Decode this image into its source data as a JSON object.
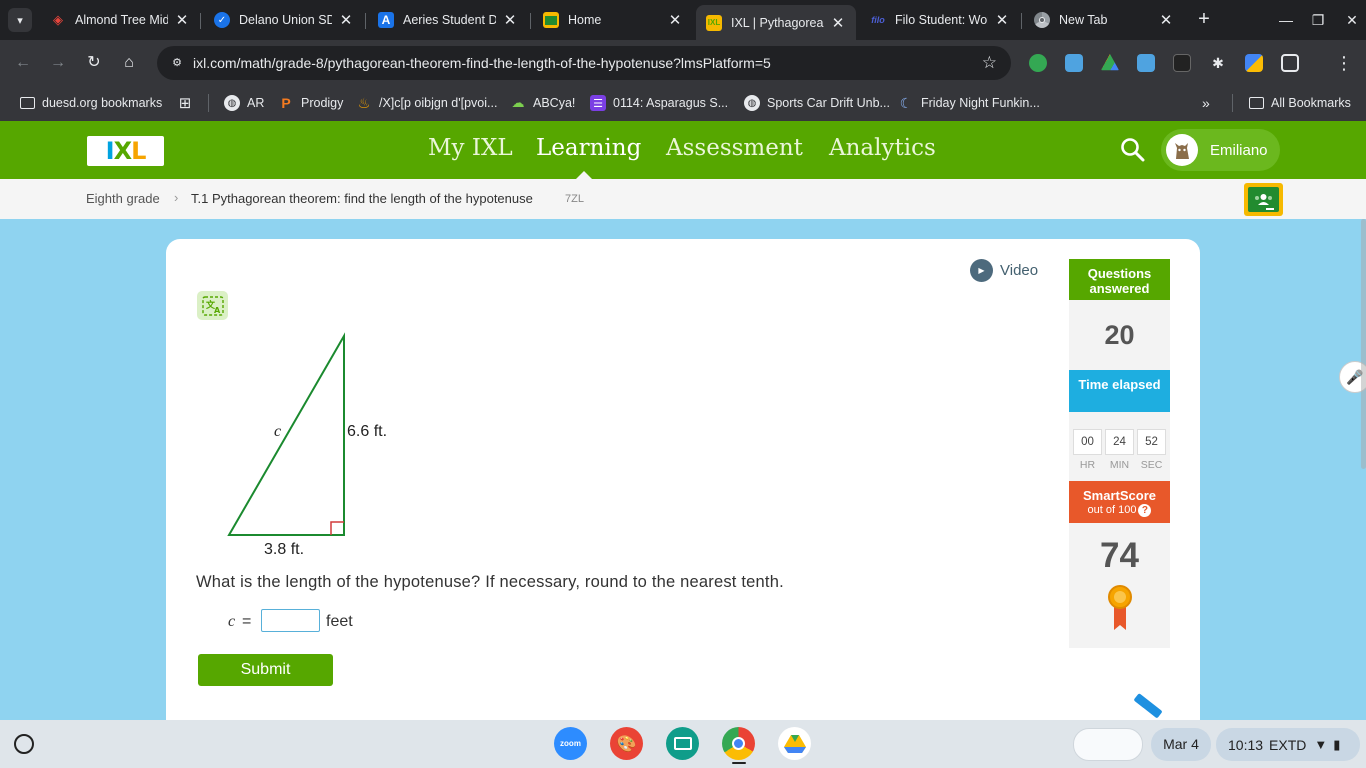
{
  "browser": {
    "tabs": [
      {
        "title": "Almond Tree Mid",
        "icon": "almond-tree-icon",
        "color": "#e8453c"
      },
      {
        "title": "Delano Union SD",
        "icon": "delano-icon",
        "color": "#1a73e8"
      },
      {
        "title": "Aeries Student Da",
        "icon": "aeries-icon",
        "color": "#1a73e8"
      },
      {
        "title": "Home",
        "icon": "classroom-icon",
        "color": "#f6b900"
      },
      {
        "title": "IXL | Pythagorean",
        "icon": "ixl-icon",
        "color": "#56a700",
        "active": true
      },
      {
        "title": "Filo Student: Wor",
        "icon": "filo-icon",
        "color": "#4c5fd5"
      },
      {
        "title": "New Tab",
        "icon": "chrome-icon",
        "color": "#9aa0a6"
      }
    ],
    "url": "ixl.com/math/grade-8/pythagorean-theorem-find-the-length-of-the-hypotenuse?lmsPlatform=5",
    "bookmarks": [
      {
        "label": "duesd.org bookmarks",
        "icon": "folder-icon"
      },
      {
        "label": "AR",
        "icon": "globe-icon"
      },
      {
        "label": "Prodigy",
        "icon": "prodigy-icon"
      },
      {
        "label": "/X]c[p oibjgn d'[pvoi...",
        "icon": "flame-icon"
      },
      {
        "label": "ABCya!",
        "icon": "abcya-icon"
      },
      {
        "label": "0114: Asparagus S...",
        "icon": "list-icon"
      },
      {
        "label": "Sports Car Drift Unb...",
        "icon": "globe-icon"
      },
      {
        "label": "Friday Night Funkin...",
        "icon": "moon-icon"
      }
    ],
    "all_bookmarks": "All Bookmarks"
  },
  "ixl": {
    "logo": {
      "l1": "I",
      "l2": "X",
      "l3": "L"
    },
    "nav": [
      "My IXL",
      "Learning",
      "Assessment",
      "Analytics"
    ],
    "active_nav": "Learning",
    "user_name": "Emiliano",
    "breadcrumb": {
      "grade": "Eighth grade",
      "skill": "T.1 Pythagorean theorem: find the length of the hypotenuse",
      "code": "7ZL"
    },
    "video_label": "Video",
    "triangle": {
      "hyp_label": "c",
      "height_label": "6.6 ft.",
      "base_label": "3.8 ft."
    },
    "question": "What is the length of the hypotenuse? If necessary, round to the nearest tenth.",
    "answer": {
      "var": "c",
      "eq": "=",
      "value": "",
      "unit": "feet"
    },
    "submit_label": "Submit",
    "sidebar": {
      "qa_title": "Questions answered",
      "qa_value": "20",
      "time_title": "Time elapsed",
      "time": {
        "hr": "00",
        "min": "24",
        "sec": "52"
      },
      "time_labels": {
        "hr": "HR",
        "min": "MIN",
        "sec": "SEC"
      },
      "ss_title": "SmartScore",
      "ss_sub": "out of 100",
      "ss_value": "74"
    },
    "colors": {
      "green": "#56a700",
      "blue": "#1eaee0",
      "orange": "#e8582a",
      "sky": "#8fd3f0"
    }
  },
  "shelf": {
    "apps": [
      "zoom",
      "paint",
      "classroom",
      "chrome",
      "drive"
    ],
    "date": "Mar 4",
    "time": "10:13",
    "mode": "EXTD"
  }
}
